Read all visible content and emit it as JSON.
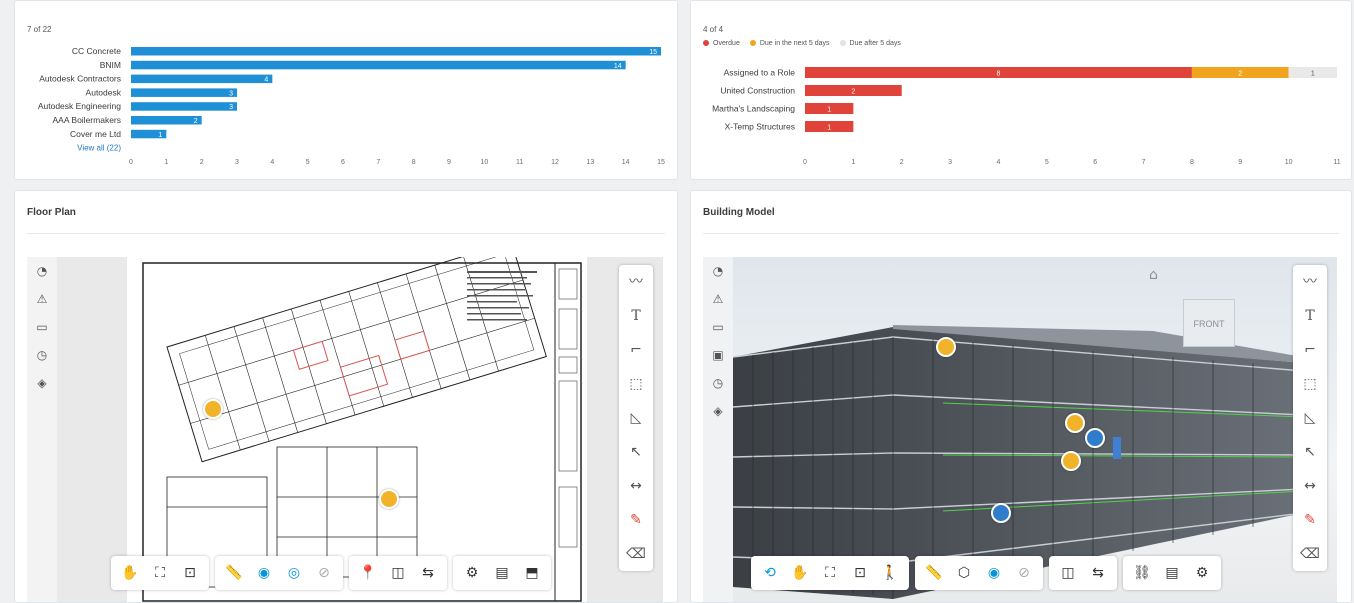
{
  "chart_data": [
    {
      "type": "bar",
      "orientation": "horizontal",
      "categories": [
        "CC Concrete",
        "BNIM",
        "Autodesk Contractors",
        "Autodesk",
        "Autodesk Engineering",
        "AAA Boilermakers",
        "Cover me Ltd"
      ],
      "values": [
        15,
        14,
        4,
        3,
        3,
        2,
        1
      ],
      "xlim": [
        0,
        15
      ],
      "xticks": [
        0,
        1,
        2,
        3,
        4,
        5,
        6,
        7,
        8,
        9,
        10,
        11,
        12,
        13,
        14,
        15
      ],
      "color": "#1f90d6"
    },
    {
      "type": "bar",
      "orientation": "horizontal",
      "stacked": true,
      "categories": [
        "Assigned to a Role",
        "United Construction",
        "Martha's Landscaping",
        "X-Temp Structures"
      ],
      "series": [
        {
          "name": "Overdue",
          "color": "#e0433a",
          "values": [
            8,
            2,
            1,
            1
          ]
        },
        {
          "name": "Due in the next 5 days",
          "color": "#f1a51f",
          "values": [
            2,
            0,
            0,
            0
          ]
        },
        {
          "name": "Due after 5 days",
          "color": "#e9e9e9",
          "values": [
            1,
            0,
            0,
            0
          ]
        }
      ],
      "xlim": [
        0,
        11
      ],
      "xticks": [
        0,
        1,
        2,
        3,
        4,
        5,
        6,
        7,
        8,
        9,
        10,
        11
      ]
    }
  ],
  "left_chart": {
    "count": "7 of 22",
    "view_all": "View all (22)"
  },
  "right_chart": {
    "count": "4 of 4",
    "legend": [
      "Overdue",
      "Due in the next 5 days",
      "Due after 5 days"
    ]
  },
  "floor_plan": {
    "title": "Floor Plan"
  },
  "building_model": {
    "title": "Building Model",
    "viewcube_label": "FRONT"
  },
  "colors": {
    "pin_yellow": "#f0b32a",
    "pin_blue": "#2f7ccc",
    "accent": "#0696d7"
  }
}
